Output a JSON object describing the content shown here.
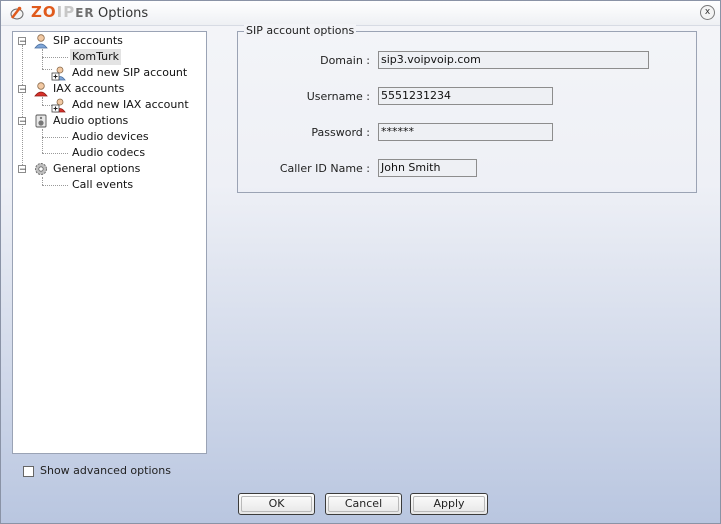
{
  "window": {
    "brand_zo": "ZO",
    "brand_ip": "IP",
    "brand_er": "ER",
    "title": "Options",
    "close_glyph": "x"
  },
  "tree": {
    "sip_accounts": "SIP accounts",
    "komturk": "KomTurk",
    "add_sip": "Add new SIP account",
    "iax_accounts": "IAX accounts",
    "add_iax": "Add new IAX account",
    "audio_options": "Audio options",
    "audio_devices": "Audio devices",
    "audio_codecs": "Audio codecs",
    "general_options": "General options",
    "call_events": "Call events",
    "expander_glyph": "−"
  },
  "advanced": {
    "label": "Show advanced options",
    "checked": false
  },
  "sip_form": {
    "group_title": "SIP account options",
    "domain_label": "Domain :",
    "domain_value": "sip3.voipvoip.com",
    "username_label": "Username :",
    "username_value": "5551231234",
    "password_label": "Password :",
    "password_value": "******",
    "callerid_label": "Caller ID Name :",
    "callerid_value": "John Smith"
  },
  "buttons": {
    "ok": "OK",
    "cancel": "Cancel",
    "apply": "Apply"
  },
  "icons": {
    "app": "zoiper-logo-icon",
    "sip": "sip-accounts-icon",
    "add_account": "add-account-icon",
    "iax": "iax-accounts-icon",
    "audio": "speaker-icon",
    "general": "gear-icon"
  },
  "colors": {
    "brand_orange": "#e05a1c",
    "window_gradient_bottom": "#b9c6e0"
  }
}
